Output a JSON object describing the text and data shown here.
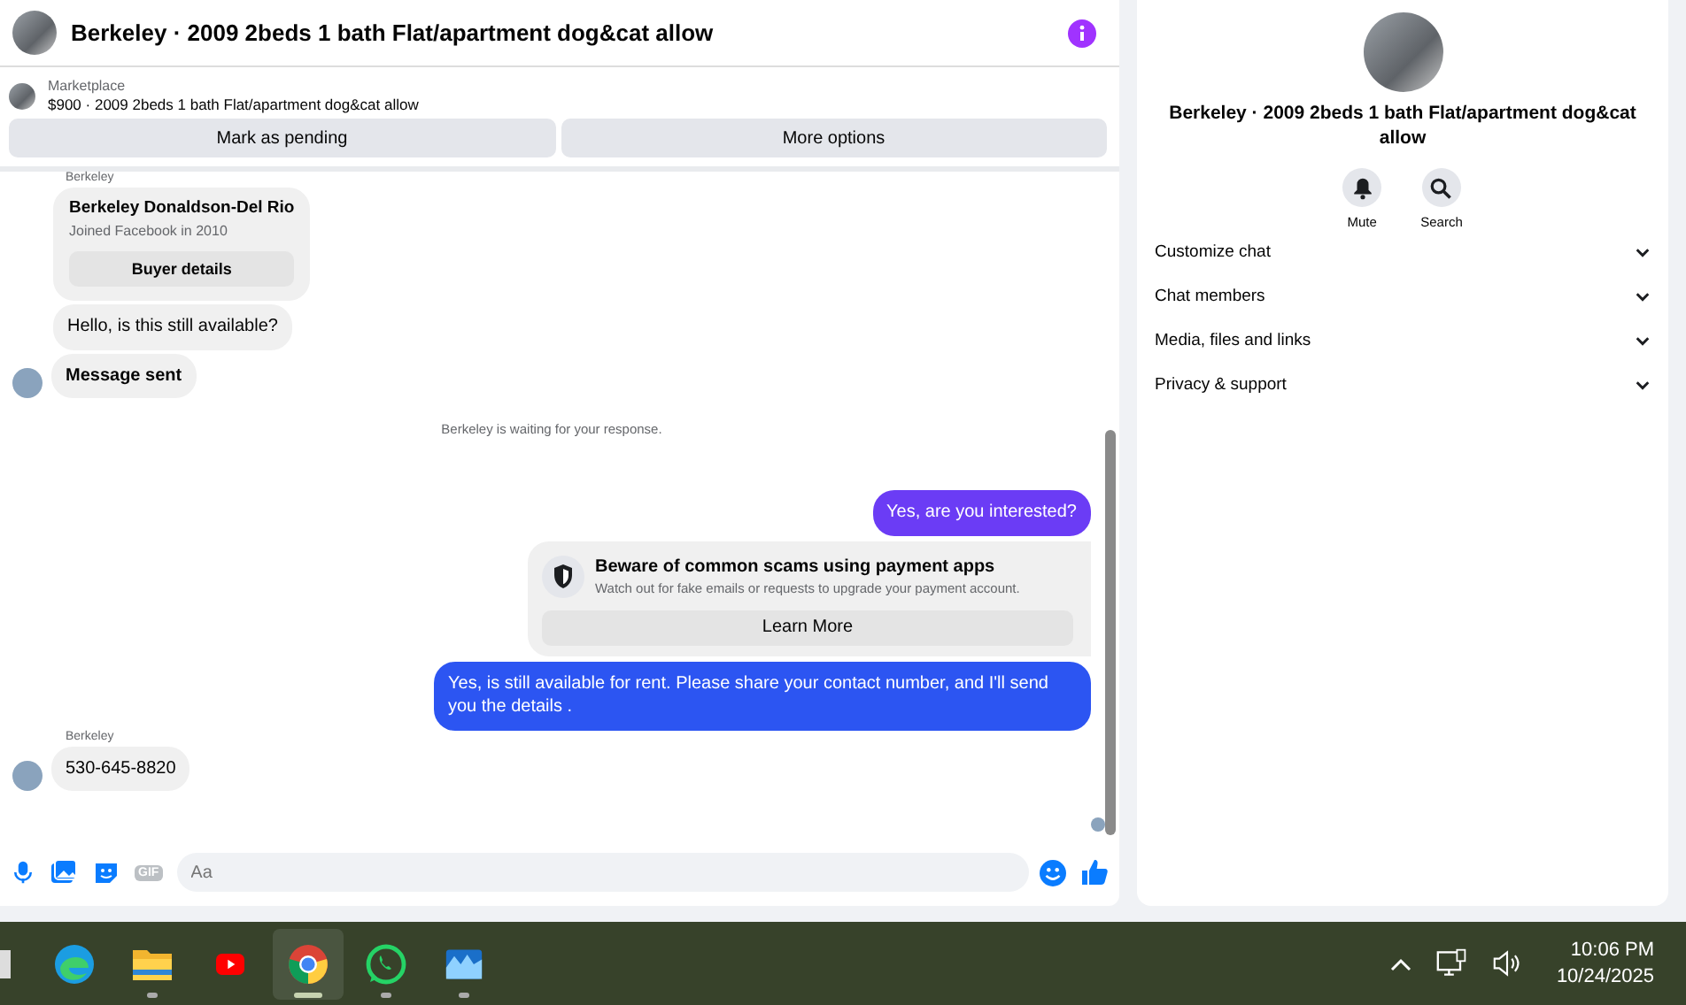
{
  "header": {
    "title": "Berkeley · 2009 2beds 1 bath Flat/apartment dog&cat allow"
  },
  "listing": {
    "source": "Marketplace",
    "summary": "$900 · 2009 2beds 1 bath Flat/apartment dog&cat allow",
    "buttons": [
      "Mark as pending",
      "More options"
    ]
  },
  "messages": [
    {
      "kind": "sender-label",
      "text": "Berkeley"
    },
    {
      "kind": "profile-card",
      "name": "Berkeley Donaldson-Del Rio",
      "detail": "Joined Facebook in 2010",
      "button": "Buyer details"
    },
    {
      "kind": "incoming",
      "text": "Hello, is this still available?",
      "avatar": false,
      "bold": false
    },
    {
      "kind": "incoming",
      "text": "Message sent",
      "avatar": true,
      "bold": true
    },
    {
      "kind": "notice",
      "text": "Berkeley is waiting for your response."
    },
    {
      "kind": "outgoing",
      "text": "Yes, are you interested?",
      "color": "#6b3cf5"
    },
    {
      "kind": "warning",
      "title": "Beware of common scams using payment apps",
      "body": "Watch out for fake emails or requests to upgrade your payment account.",
      "button": "Learn More"
    },
    {
      "kind": "outgoing",
      "text": "Yes, is still available for rent. Please share your contact number, and I'll send you the details .",
      "color": "#2c55f2"
    },
    {
      "kind": "sender-label",
      "text": "Berkeley"
    },
    {
      "kind": "incoming",
      "text": "530-645-8820",
      "avatar": true,
      "bold": false
    }
  ],
  "composer": {
    "placeholder": "Aa",
    "gif_label": "GIF"
  },
  "details": {
    "title": "Berkeley · 2009 2beds 1 bath Flat/apartment dog&cat allow",
    "actions": [
      {
        "kind": "bell",
        "label": "Mute"
      },
      {
        "kind": "search",
        "label": "Search"
      }
    ],
    "sections": [
      {
        "label": "Customize chat",
        "expanded": false
      },
      {
        "label": "Chat members",
        "expanded": false
      },
      {
        "label": "Media, files and links",
        "expanded": false
      },
      {
        "label": "Privacy & support",
        "expanded": false
      }
    ]
  },
  "taskbar": {
    "apps": [
      {
        "kind": "edge",
        "running": false,
        "selected": false
      },
      {
        "kind": "folder",
        "running": true,
        "selected": false
      },
      {
        "kind": "youtube",
        "running": false,
        "selected": false
      },
      {
        "kind": "chrome",
        "running": true,
        "selected": true
      },
      {
        "kind": "whatsapp",
        "running": true,
        "selected": false
      },
      {
        "kind": "photos",
        "running": true,
        "selected": false
      }
    ],
    "time": "10:06 PM",
    "date": "10/24/2025"
  }
}
